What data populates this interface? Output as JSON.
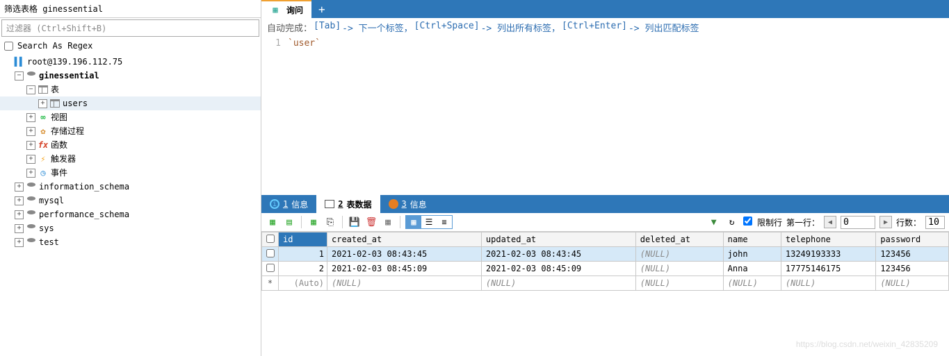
{
  "sidebar": {
    "title": "筛选表格 ginessential",
    "filter_placeholder": "过滤器 (Ctrl+Shift+B)",
    "regex_label": "Search As Regex",
    "server": "root@139.196.112.75",
    "db_active": "ginessential",
    "folders": {
      "tables": "表",
      "views": "视图",
      "procs": "存储过程",
      "funcs": "函数",
      "trigs": "触发器",
      "events": "事件"
    },
    "tables": [
      "users"
    ],
    "other_dbs": [
      "information_schema",
      "mysql",
      "performance_schema",
      "sys",
      "test"
    ]
  },
  "top_tab": {
    "query_label": "询问"
  },
  "autocomplete": {
    "prefix": "自动完成：",
    "tab_key": "[Tab]",
    "tab_action": "-> 下一个标签，",
    "ctrl_space_key": "[Ctrl+Space]",
    "ctrl_space_action": "-> 列出所有标签，",
    "ctrl_enter_key": "[Ctrl+Enter]",
    "ctrl_enter_action": "-> 列出匹配标签"
  },
  "editor": {
    "line": "1",
    "code": "`user`"
  },
  "mid_tabs": {
    "info": "信息",
    "data": "表数据",
    "info2": "信息",
    "n1": "1",
    "n2": "2",
    "n3": "3"
  },
  "toolbar": {
    "limit_label": "限制行",
    "first_row_label": "第一行：",
    "first_row_value": "0",
    "rows_label": "行数：",
    "rows_value": "10"
  },
  "grid": {
    "cols": [
      "id",
      "created_at",
      "updated_at",
      "deleted_at",
      "name",
      "telephone",
      "password"
    ],
    "rows": [
      {
        "id": "1",
        "created_at": "2021-02-03 08:43:45",
        "updated_at": "2021-02-03 08:43:45",
        "deleted_at": null,
        "name": "john",
        "telephone": "13249193333",
        "password": "123456"
      },
      {
        "id": "2",
        "created_at": "2021-02-03 08:45:09",
        "updated_at": "2021-02-03 08:45:09",
        "deleted_at": null,
        "name": "Anna",
        "telephone": "17775146175",
        "password": "123456"
      }
    ],
    "auto_label": "(Auto)",
    "null_label": "(NULL)"
  },
  "watermark": "https://blog.csdn.net/weixin_42835209"
}
